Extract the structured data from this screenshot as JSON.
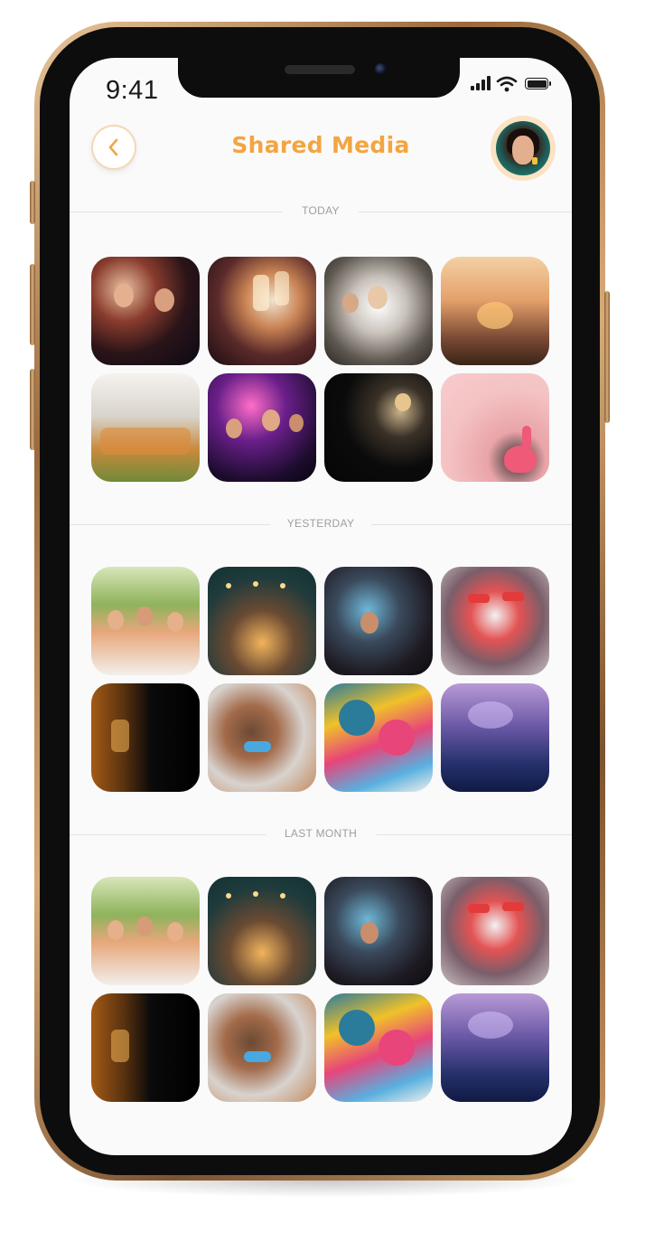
{
  "status_bar": {
    "time": "9:41"
  },
  "header": {
    "title": "Shared Media"
  },
  "icons": {
    "back": "chevron-left-icon",
    "avatar": "user-avatar",
    "signal": "signal-icon",
    "wifi": "wifi-icon",
    "battery": "battery-icon"
  },
  "colors": {
    "accent": "#f2a541",
    "avatar_ring": "#fbe2c2",
    "divider": "#e2e2e2",
    "label": "#9e9e9e"
  },
  "sections": [
    {
      "label": "TODAY",
      "photos": [
        "party-dancing",
        "champagne-toast",
        "confetti-celebration",
        "sunset-cheers",
        "buffet-serving",
        "disco-party",
        "woman-with-balloons",
        "flamingo-float"
      ]
    },
    {
      "label": "YESTERDAY",
      "photos": [
        "kids-birthday",
        "string-lights-party",
        "crowd-celebration",
        "funny-glasses",
        "golden-glasses",
        "party-blower-kids",
        "colorful-balloons",
        "concert-crowd"
      ]
    },
    {
      "label": "LAST MONTH",
      "photos": [
        "kids-birthday",
        "string-lights-party",
        "crowd-celebration",
        "funny-glasses",
        "golden-glasses",
        "party-blower-kids",
        "colorful-balloons",
        "concert-crowd"
      ]
    }
  ]
}
